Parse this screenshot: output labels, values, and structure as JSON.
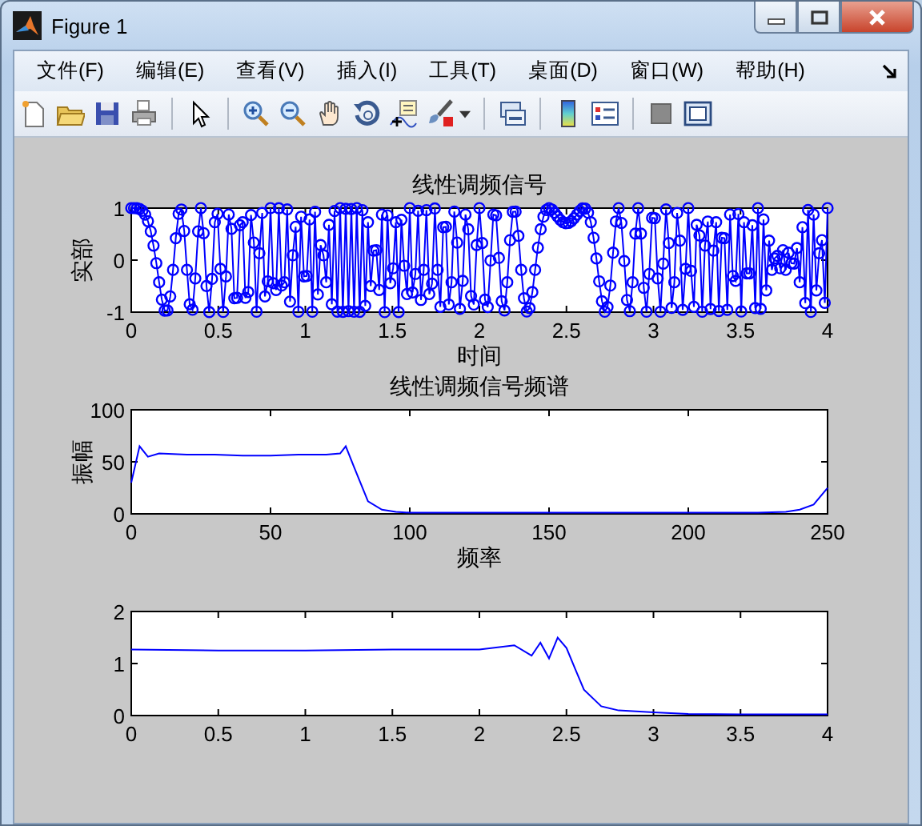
{
  "window": {
    "title": "Figure 1"
  },
  "menu": [
    "文件(F)",
    "编辑(E)",
    "查看(V)",
    "插入(I)",
    "工具(T)",
    "桌面(D)",
    "窗口(W)",
    "帮助(H)"
  ],
  "axes": [
    {
      "title": "线性调频信号",
      "ylabel": "实部",
      "xlabel": "时间",
      "xticks": [
        "0",
        "0.5",
        "1",
        "1.5",
        "2",
        "2.5",
        "3",
        "3.5",
        "4"
      ],
      "yticks": [
        "1",
        "0",
        "-1"
      ]
    },
    {
      "chart_data": {
        "type": "line",
        "title": "线性调频信号频谱",
        "xlabel": "频率",
        "ylabel": "振幅",
        "xlim": [
          0,
          250
        ],
        "ylim": [
          0,
          100
        ],
        "xticks": [
          0,
          50,
          100,
          150,
          200,
          250
        ],
        "yticks": [
          0,
          50,
          100
        ],
        "x": [
          0,
          3,
          6,
          10,
          20,
          30,
          40,
          50,
          60,
          70,
          75,
          77,
          80,
          85,
          90,
          95,
          100,
          120,
          150,
          200,
          225,
          235,
          240,
          245,
          250
        ],
        "series": [
          {
            "color": "#0000ff",
            "values": [
              30,
              65,
              55,
              58,
              57,
              57,
              56,
              56,
              57,
              57,
              58,
              65,
              45,
              12,
              4,
              2,
              1,
              1,
              1,
              1,
              1,
              2,
              4,
              9,
              25
            ]
          }
        ]
      }
    },
    {
      "chart_data": {
        "type": "line",
        "xlim": [
          0,
          4
        ],
        "ylim": [
          0,
          2
        ],
        "xticks": [
          0,
          0.5,
          1,
          1.5,
          2,
          2.5,
          3,
          3.5,
          4
        ],
        "yticks": [
          0,
          1,
          2
        ],
        "x": [
          0,
          0.5,
          1,
          1.5,
          2,
          2.2,
          2.3,
          2.35,
          2.4,
          2.45,
          2.5,
          2.55,
          2.6,
          2.7,
          2.8,
          3,
          3.2,
          3.5,
          4
        ],
        "series": [
          {
            "color": "#0000ff",
            "values": [
              1.27,
              1.25,
              1.25,
              1.27,
              1.27,
              1.35,
              1.15,
              1.4,
              1.1,
              1.5,
              1.3,
              0.9,
              0.5,
              0.18,
              0.1,
              0.06,
              0.03,
              0.02,
              0.02
            ]
          }
        ]
      }
    }
  ]
}
